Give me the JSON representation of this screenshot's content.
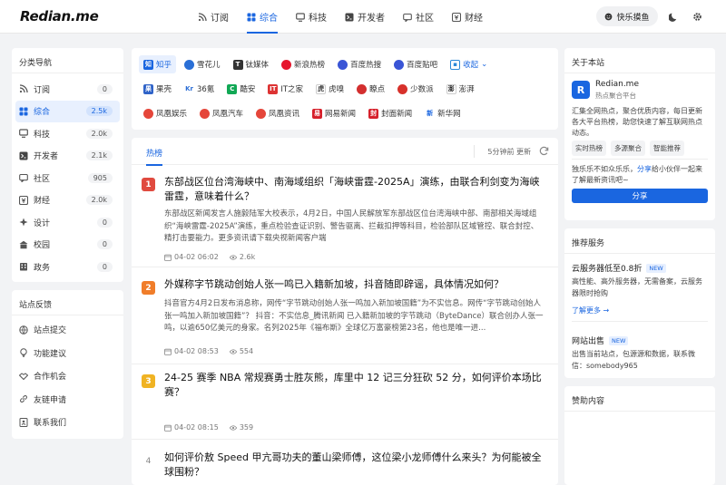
{
  "app": {
    "logo": "Redian.me"
  },
  "nav": [
    {
      "label": "订阅",
      "icon": "rss-icon"
    },
    {
      "label": "综合",
      "icon": "grid-icon",
      "active": true
    },
    {
      "label": "科技",
      "icon": "monitor-icon"
    },
    {
      "label": "开发者",
      "icon": "terminal-icon"
    },
    {
      "label": "社区",
      "icon": "community-icon"
    },
    {
      "label": "财经",
      "icon": "finance-icon"
    }
  ],
  "topbar": {
    "mood_label": "快乐摸鱼"
  },
  "sidebar": {
    "title": "分类导航",
    "items": [
      {
        "label": "订阅",
        "count": "0"
      },
      {
        "label": "综合",
        "count": "2.5k",
        "active": true
      },
      {
        "label": "科技",
        "count": "2.0k"
      },
      {
        "label": "开发者",
        "count": "2.1k"
      },
      {
        "label": "社区",
        "count": "905"
      },
      {
        "label": "财经",
        "count": "2.0k"
      },
      {
        "label": "设计",
        "count": "0"
      },
      {
        "label": "校园",
        "count": "0"
      },
      {
        "label": "政务",
        "count": "0"
      }
    ]
  },
  "feedback": {
    "title": "站点反馈",
    "items": [
      {
        "label": "站点提交"
      },
      {
        "label": "功能建议"
      },
      {
        "label": "合作机会"
      },
      {
        "label": "友链申请"
      },
      {
        "label": "联系我们"
      }
    ]
  },
  "sources": {
    "row1": [
      "知乎",
      "雪花儿",
      "钛媒体",
      "新浪热榜",
      "百度热搜",
      "百度贴吧"
    ],
    "collapse_label": "收起",
    "row2": [
      "果壳",
      "36氪",
      "酷安",
      "IT之家",
      "虎嗅",
      "瞭点",
      "少数派",
      "澎湃"
    ],
    "row3": [
      "凤凰娱乐",
      "凤凰汽车",
      "凤凰资讯",
      "网易新闻",
      "封面新闻",
      "新华网"
    ]
  },
  "feed": {
    "tab_label": "热榜",
    "update_text": "5分钟前 更新",
    "articles": [
      {
        "rank": "1",
        "title": "东部战区位台湾海峡中、南海域组织「海峡雷霆-2025A」演练，由联合利剑变为海峡雷霆，意味着什么？",
        "desc": "东部战区新闻发言人施毅陆军大校表示，4月2日，中国人民解放军东部战区位台湾海峡中部、南部相关海域组织“海峡雷霆-2025A”演练，重点检验查证识别、警告驱离、拦截扣押等科目，检验部队区域管控、联合封控、精打击要能力。更多资讯请下载央视新闻客户端",
        "date": "04-02 06:02",
        "views": "2.6k"
      },
      {
        "rank": "2",
        "title": "外媒称字节跳动创始人张一鸣已入籍新加坡，抖音随即辟谣，具体情况如何？",
        "desc": "抖音官方4月2日发布消息称，网传“字节跳动创始人张一鸣加入新加坡国籍”为不实信息。网传“字节跳动创始人张一鸣加入新加坡国籍”？ 抖音：不实信息_腾讯新闻 已入籍新加坡的字节跳动（ByteDance）联合创办人张一鸣，以逾650亿美元的身家。名列2025年《福布斯》全球亿万富豪榜第23名，他也是唯一进...",
        "date": "04-02 08:53",
        "views": "554"
      },
      {
        "rank": "3",
        "title": "24-25 赛季 NBA 常规赛勇士胜灰熊，库里中 12 记三分狂砍 52 分，如何评价本场比赛？",
        "desc": "",
        "date": "04-02 08:15",
        "views": "359"
      },
      {
        "rank": "4",
        "title": "如何评价敖 Speed 甲亢哥功夫的董山梁师傅，这位梁小龙师傅什么来头？为何能被全球围粉？",
        "desc": "",
        "date": "",
        "views": ""
      }
    ]
  },
  "about": {
    "title": "关于本站",
    "logo_letter": "R",
    "name": "Redian.me",
    "subtitle": "热点聚合平台",
    "desc": "汇集全网热点，聚合优质内容，每日更新各大平台热榜，助您快速了解互联网热点动态。",
    "tags": [
      "实时热榜",
      "多源聚合",
      "智能推荐"
    ],
    "share_text_pre": "独乐乐不如众乐乐，",
    "share_text_hl": "分享",
    "share_text_post": "给小伙伴一起来了解最新资讯吧~",
    "share_button": "分享"
  },
  "services": {
    "title": "推荐服务",
    "items": [
      {
        "name": "云服务器低至0.8折",
        "badge": "NEW",
        "desc": "高性能、高外服务器，无需备案，云服务器限时抢购",
        "link": "了解更多 →"
      },
      {
        "name": "网站出售",
        "badge": "NEW",
        "desc": "出售当前站点，包源源和数据，联系微信：somebody965",
        "link": ""
      }
    ]
  },
  "sponsor": {
    "title": "赞助内容"
  },
  "colors": {
    "accent": "#1a66e0",
    "rank1": "#e04a3f",
    "rank2": "#f07d2a",
    "rank3": "#f0b323"
  }
}
